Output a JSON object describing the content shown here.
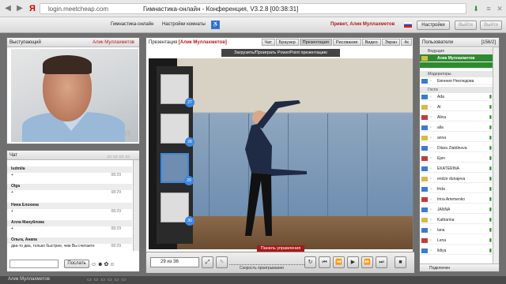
{
  "browser": {
    "url": "login.meetcheap.com",
    "title": "Гимнастика-онлайн - Конференция, V3.2.8 [00:38:31]",
    "logo": "Я"
  },
  "topbar": {
    "links": [
      "Гимнастика-онлайн",
      "Настройки комнаты"
    ],
    "greeting": "Привет, Алик Муллахметов",
    "settings_label": "Настройки",
    "exit_label": "Выйти",
    "logout_label": "Выйти"
  },
  "speaker": {
    "header": "Выступающий",
    "name": "Алик Муллахметов"
  },
  "chat": {
    "header": "Чат",
    "messages": [
      {
        "name": "ludmila",
        "text": "+",
        "time": "08:29"
      },
      {
        "name": "Olga",
        "text": "+",
        "time": "08:29"
      },
      {
        "name": "Нина Елохина",
        "text": "+",
        "time": "08:29"
      },
      {
        "name": "Алла Мануйлова",
        "text": "+",
        "time": "08:29"
      },
      {
        "name": "Ольга, Анапа",
        "text": "два-то два, только быстрее, чем Вы считаете",
        "time": "08:29"
      }
    ],
    "send_label": "Послать"
  },
  "presentation": {
    "title_prefix": "Презентация",
    "title_name": "[Алик Муллахметов]",
    "tabs": [
      "Чат",
      "Браузер",
      "Презентация",
      "Рисование",
      "Видео",
      "Экран",
      "4x"
    ],
    "active_tab": "Презентация",
    "upload_label": "Загрузить/Проиграть PowerPoint презентацию",
    "control_panel_label": "Панель управления",
    "page_selector": "29 из 36",
    "speed_label": "Скорость проигрывания",
    "thumb_numbers": [
      "27",
      "28",
      "29",
      "30"
    ]
  },
  "users": {
    "header": "Пользователи",
    "count": "[156/2]",
    "groups": {
      "leading": "Ведущие",
      "moderators": "Модераторы",
      "guests": "Гости"
    },
    "host": "Алик Муллахметов",
    "moderators": [
      "Евгения Неклюдова"
    ],
    "guests": [
      "Ada",
      "Al",
      "Alina",
      "alla",
      "anna",
      "Dilara Ziatdinova",
      "Ejen",
      "EKATERINA",
      "endze dunajeva",
      "frida",
      "Irina Artemenko",
      "JANNA",
      "Katharina",
      "lana",
      "Lena",
      "lidiya"
    ],
    "footer": "Подключен"
  },
  "status": {
    "name": "Алик Муллахметов"
  },
  "colors": {
    "accent_red": "#b01818",
    "host_green": "#2f8a2f",
    "thumb_blue": "#3b88e0"
  }
}
